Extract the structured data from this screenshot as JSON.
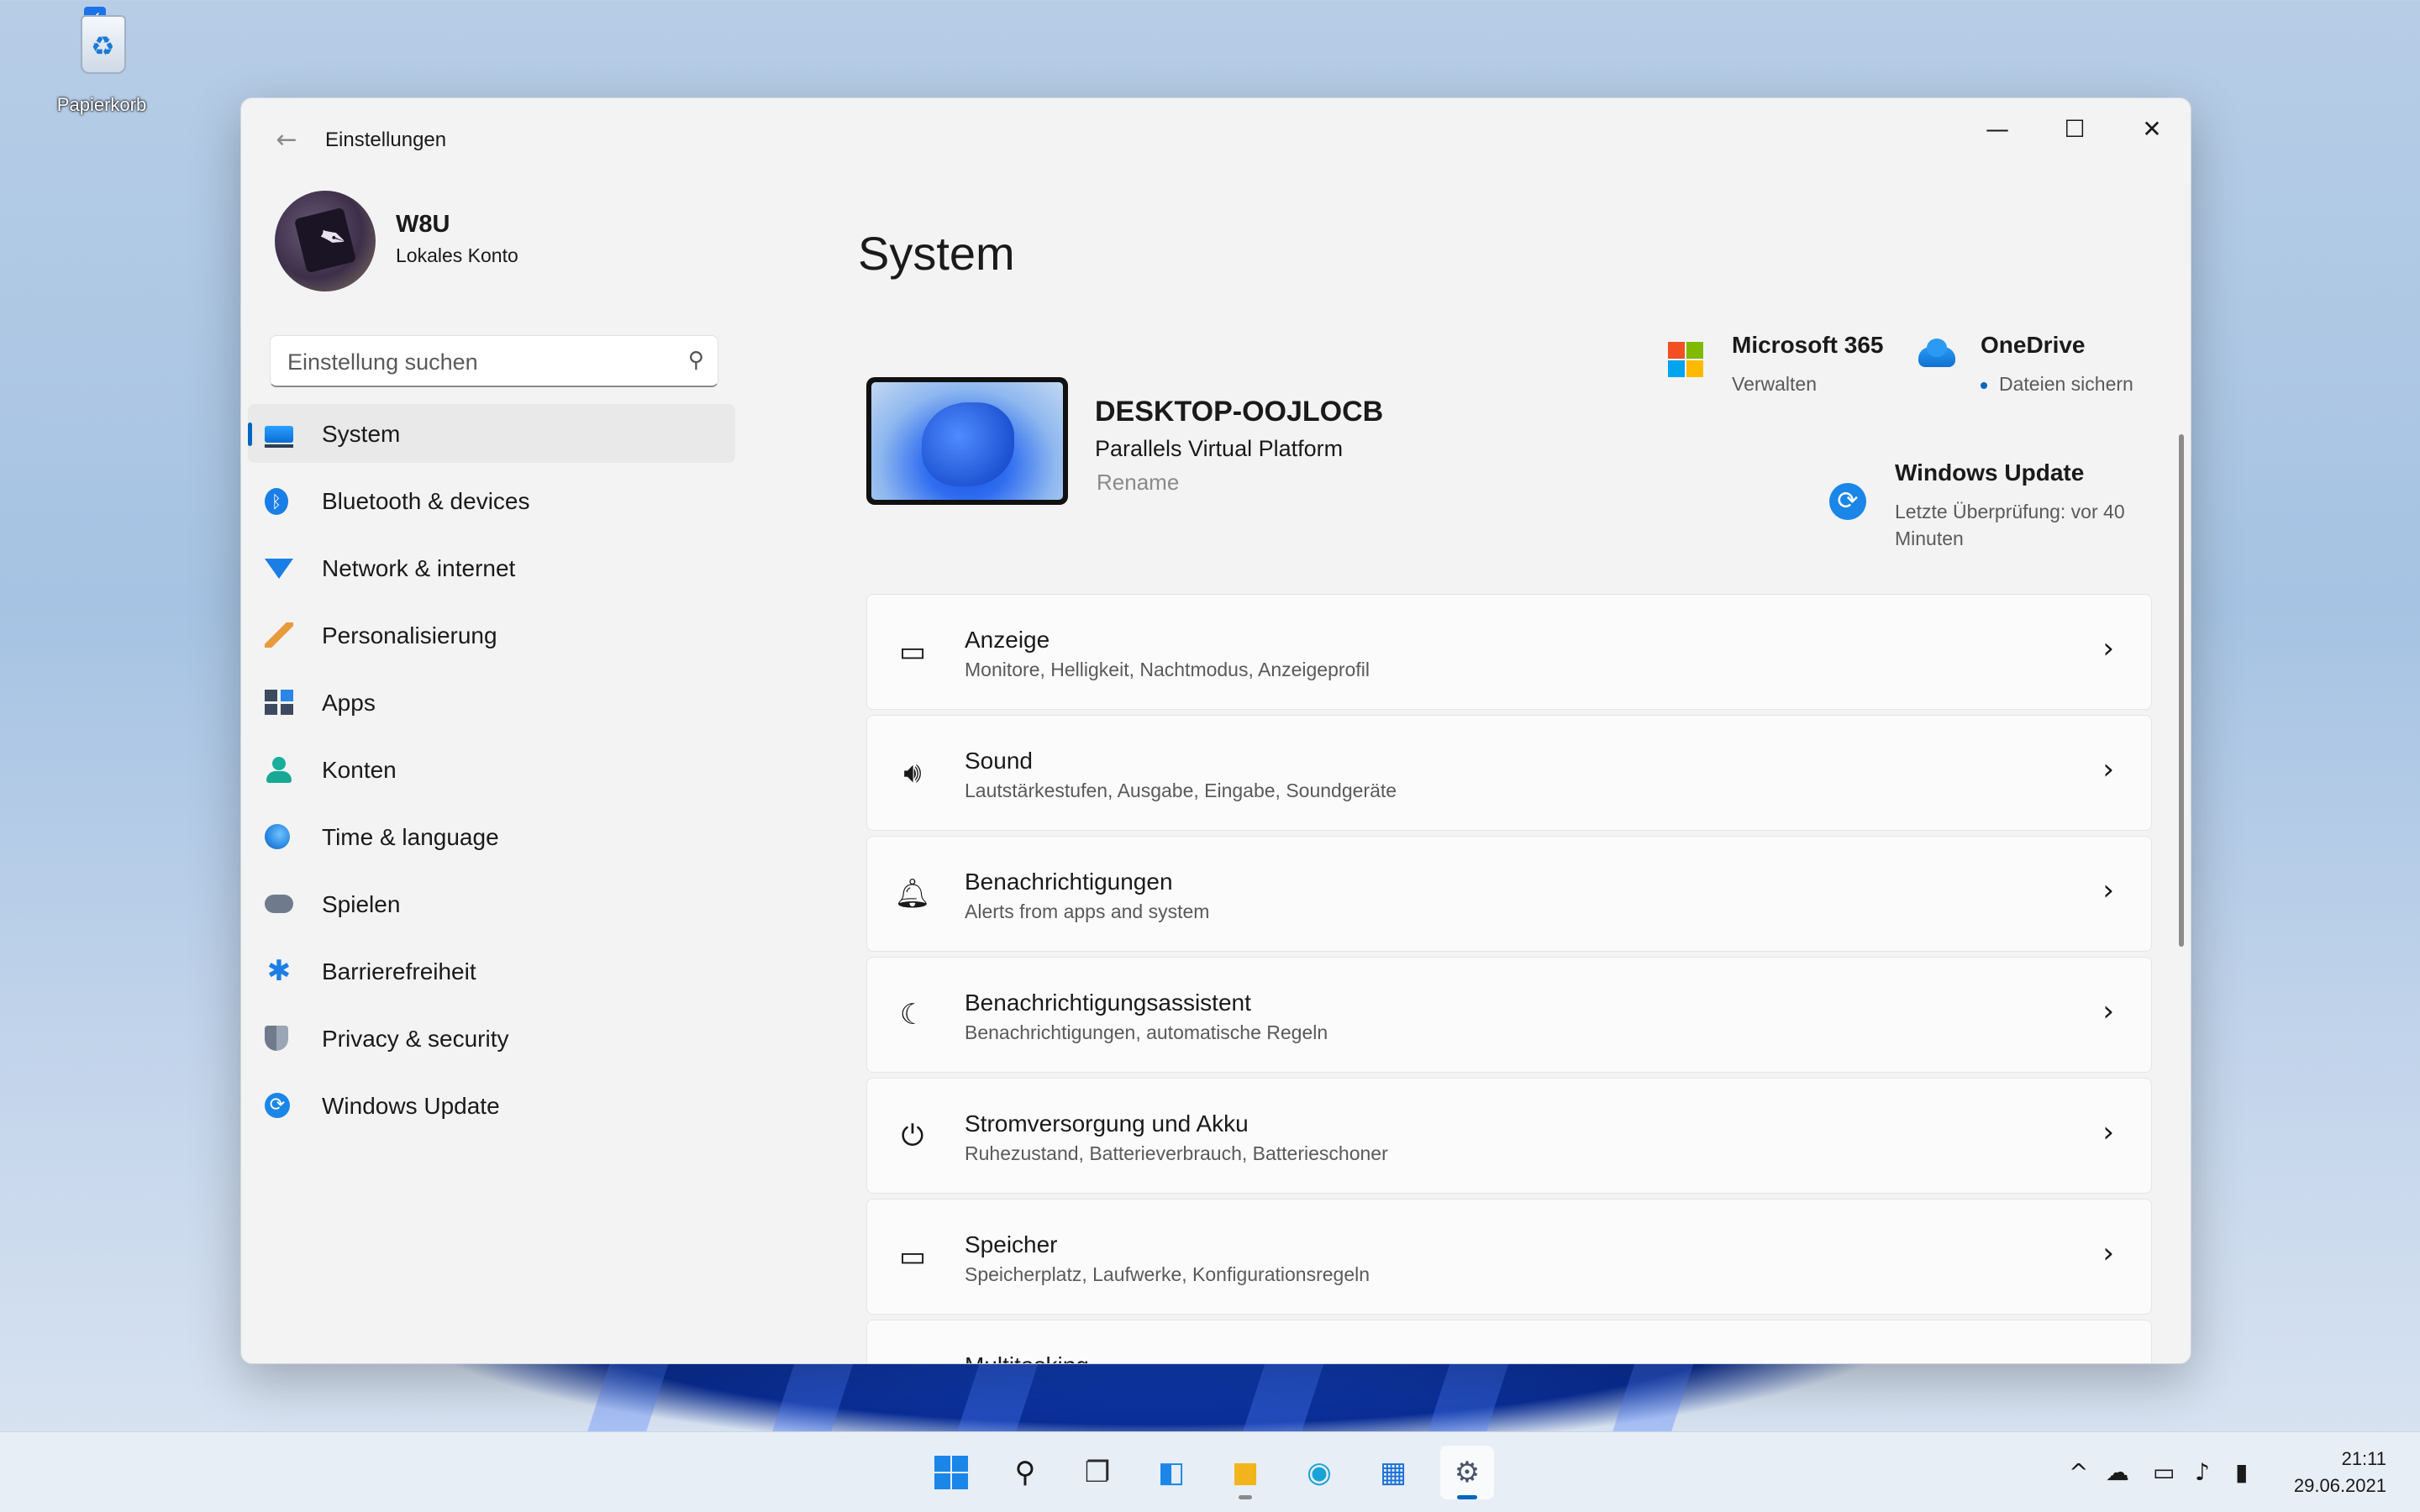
{
  "desktop": {
    "recycle_bin_label": "Papierkorb"
  },
  "window": {
    "title": "Einstellungen",
    "controls": {
      "minimize": "—",
      "maximize": "☐",
      "close": "✕"
    }
  },
  "profile": {
    "name": "W8U",
    "account_type": "Lokales Konto"
  },
  "search": {
    "placeholder": "Einstellung suchen"
  },
  "sidebar": {
    "items": [
      {
        "label": "System",
        "icon": "system-icon",
        "active": true
      },
      {
        "label": "Bluetooth & devices",
        "icon": "bluetooth-icon"
      },
      {
        "label": "Network & internet",
        "icon": "wifi-icon"
      },
      {
        "label": "Personalisierung",
        "icon": "brush-icon"
      },
      {
        "label": "Apps",
        "icon": "apps-icon"
      },
      {
        "label": "Konten",
        "icon": "person-icon"
      },
      {
        "label": "Time & language",
        "icon": "globe-clock-icon"
      },
      {
        "label": "Spielen",
        "icon": "gamepad-icon"
      },
      {
        "label": "Barrierefreiheit",
        "icon": "accessibility-icon"
      },
      {
        "label": "Privacy & security",
        "icon": "shield-icon"
      },
      {
        "label": "Windows Update",
        "icon": "update-icon"
      }
    ]
  },
  "main": {
    "title": "System",
    "device": {
      "name": "DESKTOP-OOJLOCB",
      "model": "Parallels Virtual Platform",
      "rename": "Rename"
    },
    "quick": {
      "microsoft365": {
        "title": "Microsoft 365",
        "subtitle": "Verwalten"
      },
      "onedrive": {
        "title": "OneDrive",
        "subtitle": "Dateien sichern"
      },
      "windows_update": {
        "title": "Windows Update",
        "subtitle": "Letzte Überprüfung: vor 40 Minuten"
      }
    },
    "cards": [
      {
        "title": "Anzeige",
        "subtitle": "Monitore, Helligkeit, Nachtmodus, Anzeigeprofil",
        "icon": "display-icon"
      },
      {
        "title": "Sound",
        "subtitle": "Lautstärkestufen, Ausgabe, Eingabe, Soundgeräte",
        "icon": "speaker-icon"
      },
      {
        "title": "Benachrichtigungen",
        "subtitle": "Alerts from apps and system",
        "icon": "bell-icon"
      },
      {
        "title": "Benachrichtigungsassistent",
        "subtitle": "Benachrichtigungen, automatische Regeln",
        "icon": "moon-icon"
      },
      {
        "title": "Stromversorgung und Akku",
        "subtitle": "Ruhezustand, Batterieverbrauch, Batterieschoner",
        "icon": "power-icon"
      },
      {
        "title": "Speicher",
        "subtitle": "Speicherplatz, Laufwerke, Konfigurationsregeln",
        "icon": "storage-icon"
      },
      {
        "title": "Multitasking",
        "subtitle": "",
        "icon": "multitasking-icon"
      }
    ]
  },
  "taskbar": {
    "clock_time": "21:11",
    "clock_date": "29.06.2021"
  },
  "colors": {
    "accent": "#0067c0",
    "window_bg": "#f3f3f3",
    "card_bg": "#fbfbfb"
  }
}
